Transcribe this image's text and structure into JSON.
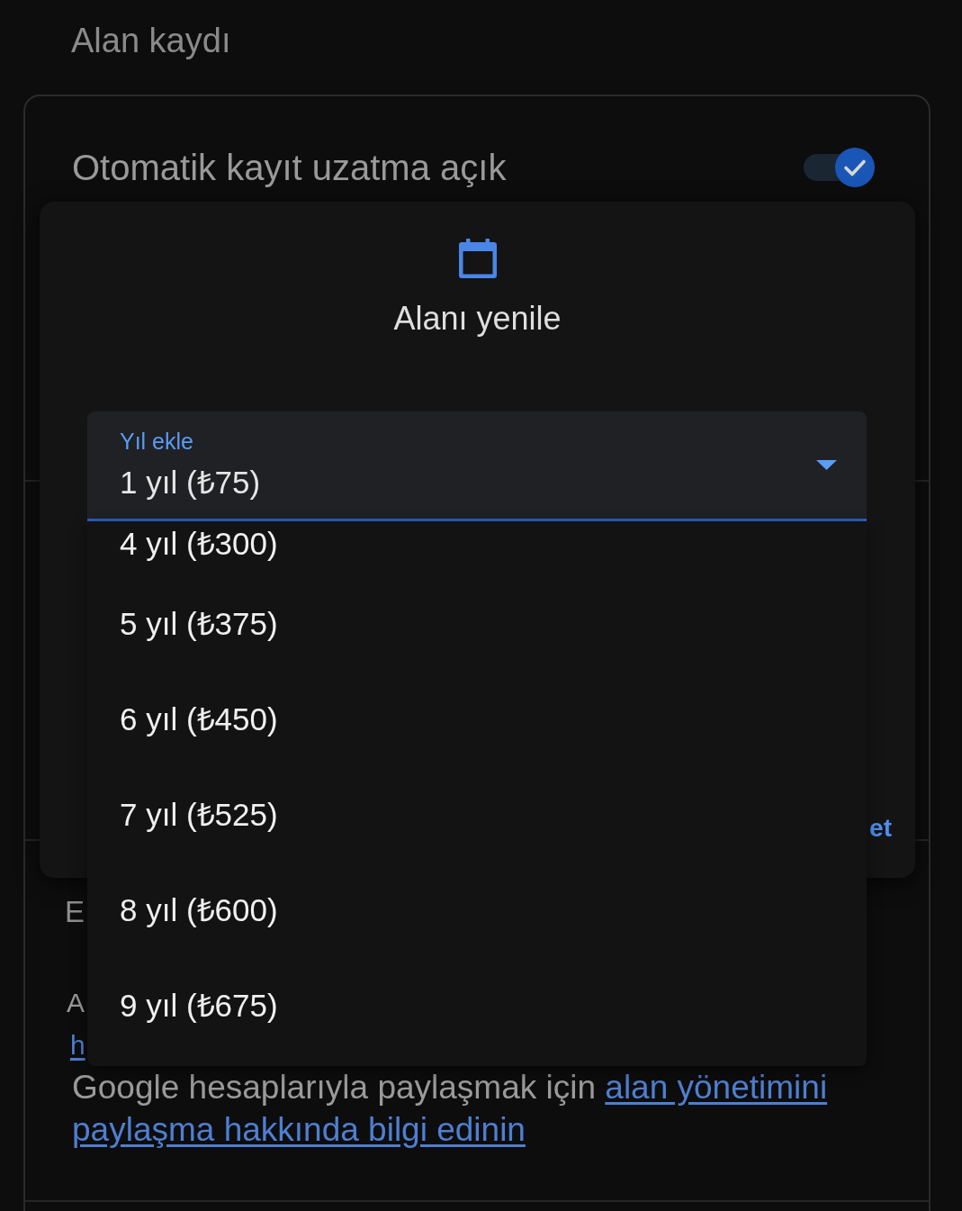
{
  "page_title": "Alan kaydı",
  "auto_renew": {
    "label": "Otomatik kayıt uzatma açık",
    "on": true
  },
  "dialog": {
    "title": "Alanı yenile",
    "select": {
      "label": "Yıl ekle",
      "value": "1 yıl (₺75)",
      "options": [
        {
          "label": "4 yıl (₺300)",
          "selected": false
        },
        {
          "label": "5 yıl (₺375)",
          "selected": false
        },
        {
          "label": "6 yıl (₺450)",
          "selected": false
        },
        {
          "label": "7 yıl (₺525)",
          "selected": false
        },
        {
          "label": "8 yıl (₺600)",
          "selected": false
        },
        {
          "label": "9 yıl (₺675)",
          "selected": false
        }
      ]
    },
    "button_fragment": "et"
  },
  "sharing_section": {
    "heading_fragment": "E",
    "text_fragment": "A",
    "link_fragment": "h",
    "text": "Google hesaplarıyla paylaşmak için",
    "links": [
      "alan yönetimini",
      "paylaşma hakkında bilgi edinin"
    ]
  }
}
